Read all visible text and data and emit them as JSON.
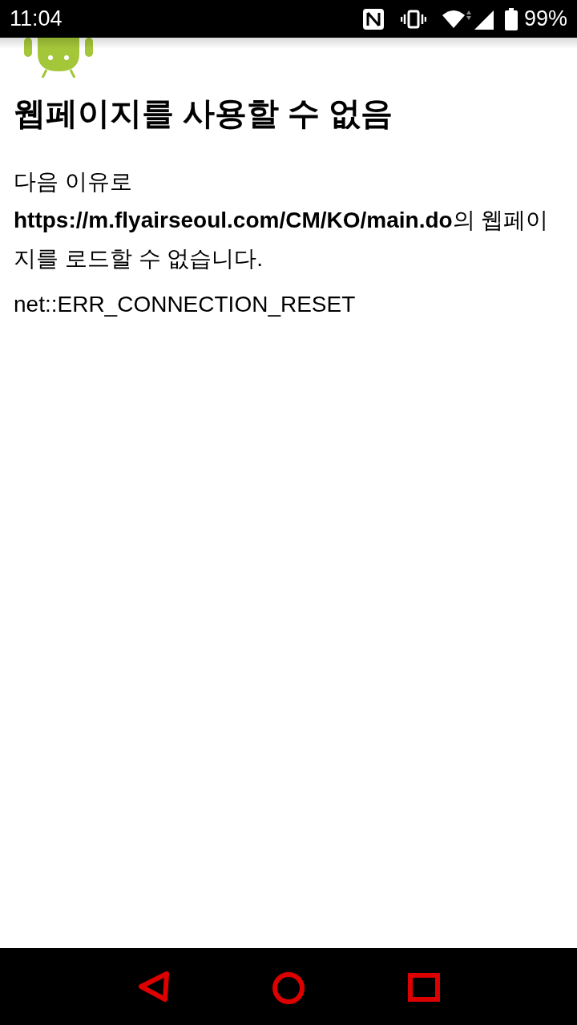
{
  "status_bar": {
    "time": "11:04",
    "battery": "99%"
  },
  "page": {
    "title": "웹페이지를 사용할 수 없음",
    "message": "다음 이유로 **https://m.flyairseoul.com/CM/KO/main.do**의 웹페이지를 로드할 수 없습니다.",
    "error_code": "net::ERR_CONNECTION_RESET"
  },
  "nav_bar": {
    "buttons": [
      {
        "kind": "back"
      },
      {
        "kind": "home"
      },
      {
        "kind": "recents"
      }
    ]
  }
}
